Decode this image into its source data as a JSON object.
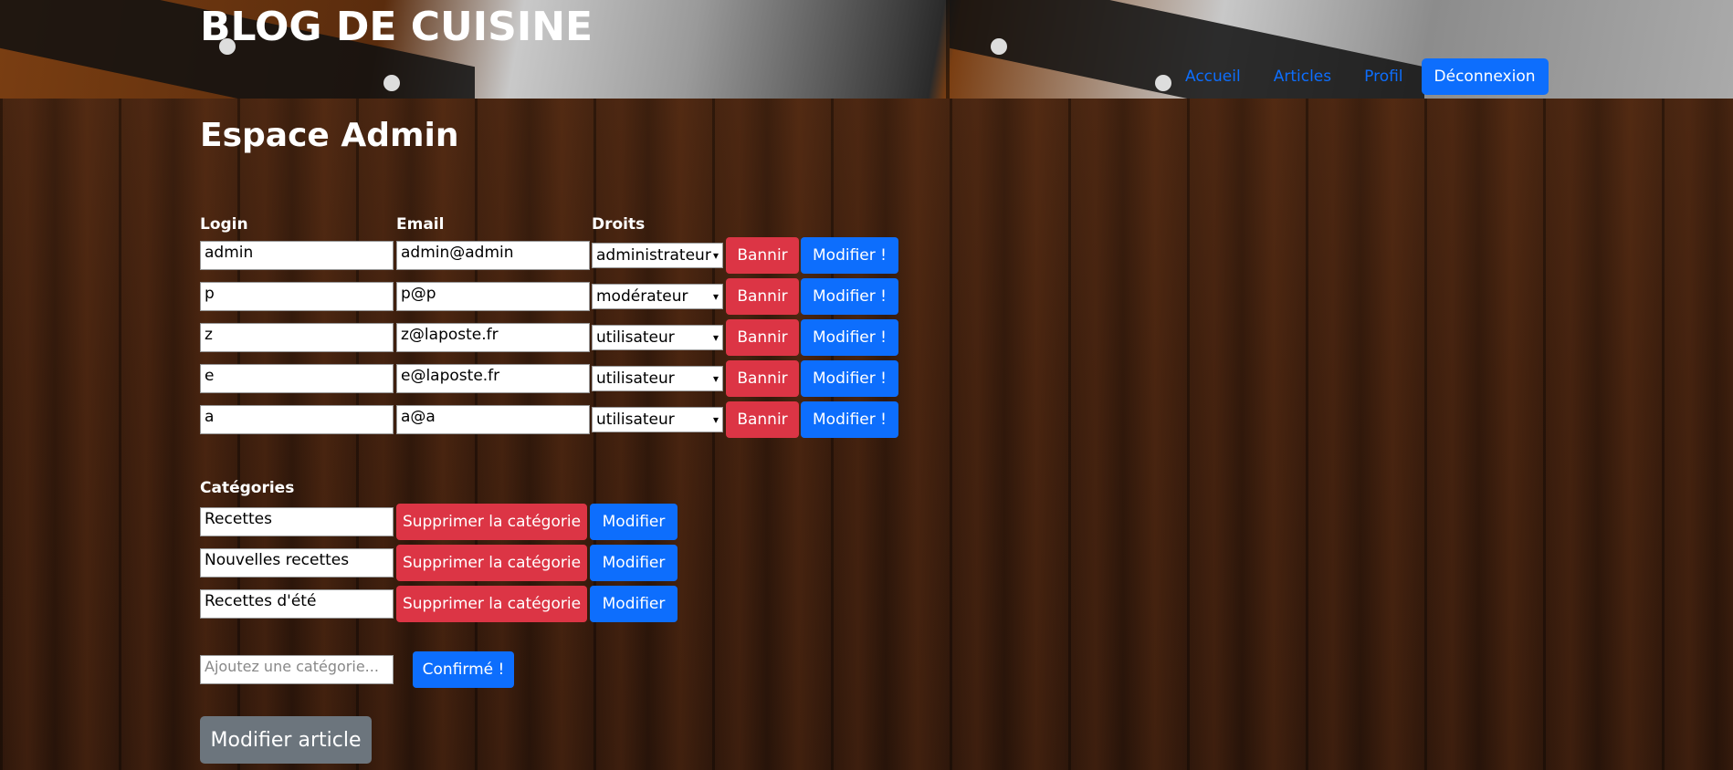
{
  "site": {
    "title": "BLOG DE CUISINE"
  },
  "nav": {
    "home": "Accueil",
    "articles": "Articles",
    "profile": "Profil",
    "logout": "Déconnexion"
  },
  "page": {
    "title": "Espace Admin"
  },
  "users": {
    "headers": {
      "login": "Login",
      "email": "Email",
      "rights": "Droits"
    },
    "ban_label": "Bannir",
    "modify_label": "Modifier !",
    "rows": [
      {
        "login": "admin",
        "email": "admin@admin",
        "rights": "administrateur"
      },
      {
        "login": "p",
        "email": "p@p",
        "rights": "modérateur"
      },
      {
        "login": "z",
        "email": "z@laposte.fr",
        "rights": "utilisateur"
      },
      {
        "login": "e",
        "email": "e@laposte.fr",
        "rights": "utilisateur"
      },
      {
        "login": "a",
        "email": "a@a",
        "rights": "utilisateur"
      }
    ]
  },
  "categories": {
    "header": "Catégories",
    "delete_label": "Supprimer la catégorie",
    "modify_label": "Modifier",
    "rows": [
      {
        "name": "Recettes"
      },
      {
        "name": "Nouvelles recettes"
      },
      {
        "name": "Recettes d'été"
      }
    ],
    "add_placeholder": "Ajoutez une catégorie...",
    "confirm_label": "Confirmé !"
  },
  "article": {
    "modify_label": "Modifier article"
  },
  "colors": {
    "primary": "#0d6efd",
    "danger": "#dc3545",
    "secondary": "#6c757d"
  }
}
